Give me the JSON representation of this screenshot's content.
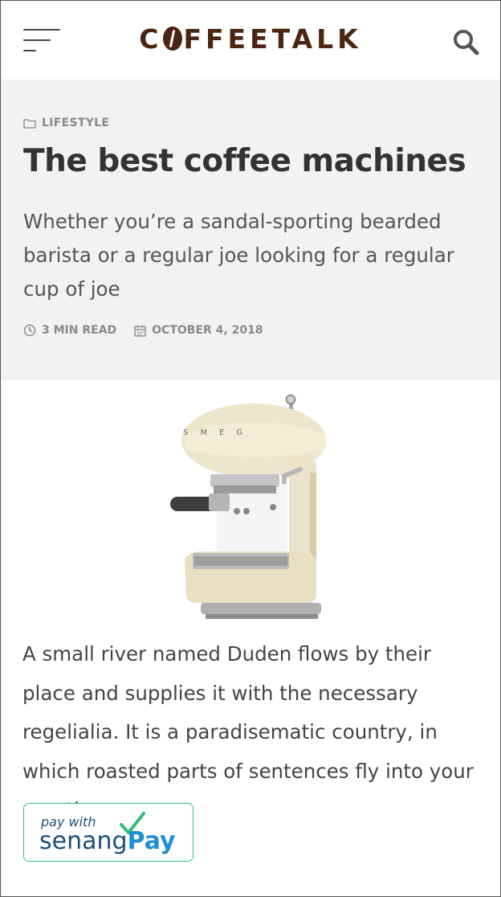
{
  "header": {
    "logo_before": "C",
    "logo_after": "FFEETALK",
    "menu_icon": "hamburger-menu-icon",
    "search_icon": "search-icon"
  },
  "article": {
    "category": "LIFESTYLE",
    "title": "The best coffee machines",
    "subtitle": "Whether you’re a sandal-sporting bearded barista or a regular joe looking for a regular cup of joe",
    "read_time": "3 MIN READ",
    "date": "OCTOBER 4, 2018",
    "image_icon": "espresso-machine-image",
    "body": "A small river named Duden flows by their place and supplies it with the necessary regelialia. It is a paradisematic country, in which roasted parts of sentences fly into your mouth."
  },
  "payment": {
    "small_text": "pay with",
    "brand_text": "senang",
    "brand_bold": "Pay"
  },
  "colors": {
    "logo": "#4a2511",
    "hero_bg": "#f2f2f2",
    "pay_border": "#2fbf7a",
    "pay_blue": "#1f8fd0"
  }
}
